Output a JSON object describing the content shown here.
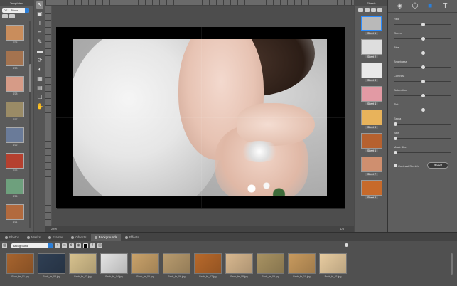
{
  "templates": {
    "title": "Templates",
    "select_value": "DF 1 Photo",
    "items": [
      {
        "label": "1/28",
        "color": "#c98d5c"
      },
      {
        "label": "1/28",
        "color": "#a4734f"
      },
      {
        "label": "1/28",
        "color": "#d69b87"
      },
      {
        "label": "1/17",
        "color": "#9a8b66"
      },
      {
        "label": "1/22",
        "color": "#6a7b99"
      },
      {
        "label": "1/13",
        "color": "#b5402f"
      },
      {
        "label": "1/26",
        "color": "#6ea07d"
      },
      {
        "label": "1/21",
        "color": "#b26a3e"
      }
    ]
  },
  "tools": [
    "↖",
    "▣",
    "T",
    "⌗",
    "✎",
    "▬",
    "⟳",
    "◐",
    "▦",
    "▤",
    "☐",
    "✋"
  ],
  "canvas": {
    "zoom": "28%",
    "page": "1/8"
  },
  "sheets": {
    "title": "Sheets",
    "items": [
      {
        "label": "Sheet 1",
        "color": "#b9b9b9"
      },
      {
        "label": "Sheet 2",
        "color": "#dedede"
      },
      {
        "label": "Sheet 3",
        "color": "#e9e9e9"
      },
      {
        "label": "Sheet 4",
        "color": "#e29aa4"
      },
      {
        "label": "Sheet 5",
        "color": "#e8b35b"
      },
      {
        "label": "Sheet 6",
        "color": "#b6612f"
      },
      {
        "label": "Sheet 7",
        "color": "#cf8f6f"
      },
      {
        "label": "Sheet 8",
        "color": "#c76a2b"
      }
    ]
  },
  "adjustments": {
    "tab_icons": [
      "layers-icon",
      "cube-icon",
      "square-icon",
      "text-icon"
    ],
    "sliders": [
      {
        "label": "Red",
        "value": 0.5
      },
      {
        "label": "Green",
        "value": 0.5
      },
      {
        "label": "Blue",
        "value": 0.5
      },
      {
        "label": "Brightness",
        "value": 0.5
      },
      {
        "label": "Contrast",
        "value": 0.5
      },
      {
        "label": "Saturation",
        "value": 0.5
      },
      {
        "label": "Tint",
        "value": 0.5
      },
      {
        "label": "Sepia",
        "value": 0.0
      },
      {
        "label": "Blur",
        "value": 0.0
      },
      {
        "label": "Mask Blur",
        "value": 0.0
      }
    ],
    "contrast_stretch_label": "Contrast Stretch",
    "reset_label": "Reset"
  },
  "bottom": {
    "tabs": [
      {
        "label": "Photos",
        "active": false
      },
      {
        "label": "Masks",
        "active": false
      },
      {
        "label": "Frames",
        "active": false
      },
      {
        "label": "Objects",
        "active": false
      },
      {
        "label": "Backgrounds",
        "active": true
      },
      {
        "label": "Effects",
        "active": false
      }
    ],
    "select_value": "Background",
    "backgrounds": [
      {
        "label": "Back_fe_01.jpg",
        "color": "#a7642e"
      },
      {
        "label": "Back_fe_02.jpg",
        "color": "#2f3f54"
      },
      {
        "label": "Back_fe_03.jpg",
        "color": "#d8c28e"
      },
      {
        "label": "Back_fe_04.jpg",
        "color": "#e4e4e4"
      },
      {
        "label": "Back_fe_05.jpg",
        "color": "#c9a26a"
      },
      {
        "label": "Back_fe_06.jpg",
        "color": "#b89b6e"
      },
      {
        "label": "Back_fe_07.jpg",
        "color": "#b8692b"
      },
      {
        "label": "Back_fe_08.jpg",
        "color": "#d8b88f"
      },
      {
        "label": "Back_fe_09.jpg",
        "color": "#a89262"
      },
      {
        "label": "Back_fe_10.jpg",
        "color": "#c89a5e"
      },
      {
        "label": "Back_fe_11.jpg",
        "color": "#e8cca0"
      }
    ]
  },
  "colors": {
    "accent": "#2b7fd9",
    "selected_sheet": "#2b8cff"
  }
}
